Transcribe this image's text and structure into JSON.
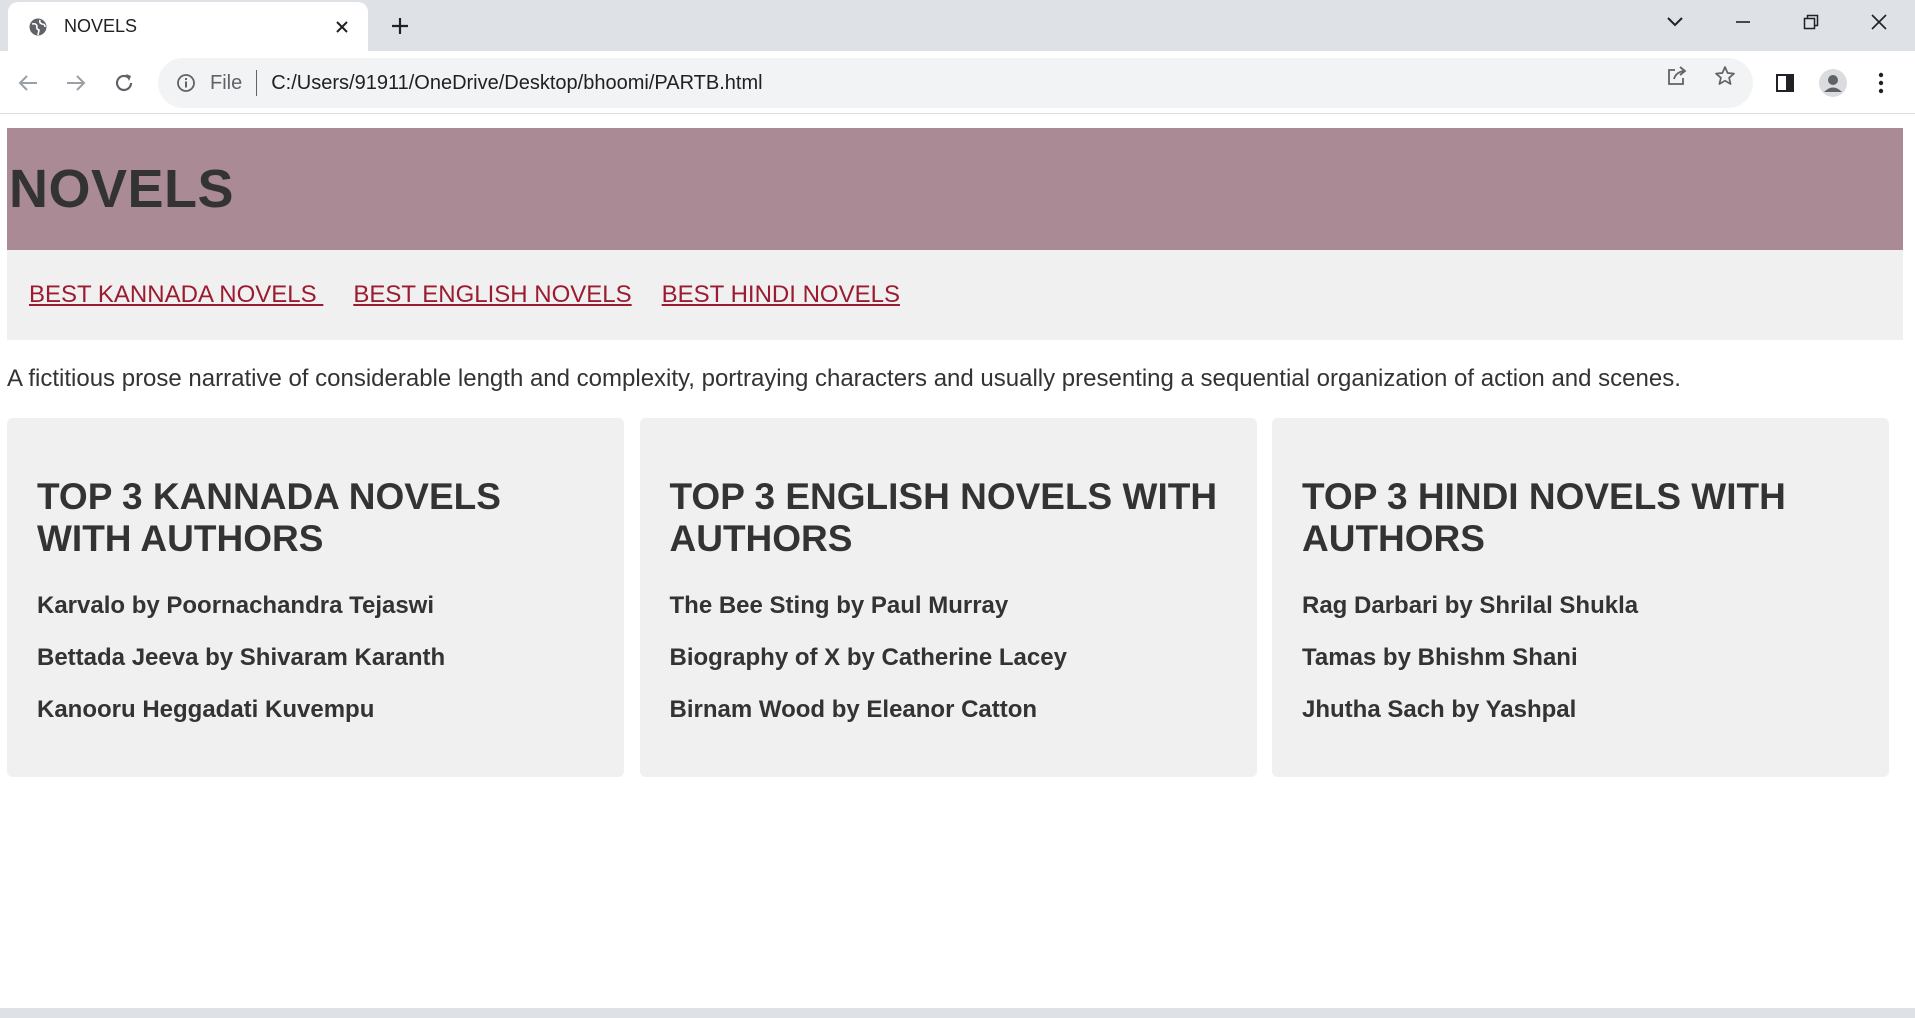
{
  "browser": {
    "tab_title": "NOVELS",
    "address_scheme": "File",
    "address_url": "C:/Users/91911/OneDrive/Desktop/bhoomi/PARTB.html"
  },
  "page": {
    "heading": "NOVELS",
    "nav_links": [
      "BEST KANNADA NOVELS ",
      "BEST ENGLISH NOVELS",
      "BEST HINDI NOVELS"
    ],
    "intro": "A fictitious prose narrative of considerable length and complexity, portraying characters and usually presenting a sequential organization of action and scenes.",
    "cards": [
      {
        "title": "TOP 3 KANNADA NOVELS WITH AUTHORS",
        "items": [
          "Karvalo by Poornachandra Tejaswi",
          "Bettada Jeeva by Shivaram Karanth",
          "Kanooru Heggadati Kuvempu"
        ]
      },
      {
        "title": "TOP 3 ENGLISH NOVELS WITH AUTHORS",
        "items": [
          "The Bee Sting by Paul Murray",
          "Biography of X by Catherine Lacey",
          "Birnam Wood by Eleanor Catton"
        ]
      },
      {
        "title": "TOP 3 HINDI NOVELS WITH AUTHORS",
        "items": [
          "Rag Darbari by Shrilal Shukla",
          "Tamas by Bhishm Shani",
          "Jhutha Sach by Yashpal"
        ]
      }
    ]
  },
  "colors": {
    "header_bg": "#aa8a94",
    "nav_bg": "#f0f0f0",
    "link": "#9b1b30",
    "text": "#333333"
  }
}
